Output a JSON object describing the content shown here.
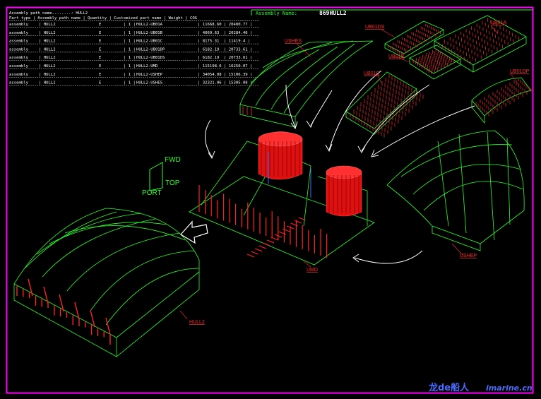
{
  "header": {
    "assembly_label": "Assembly Name:",
    "assembly_value": "869HULL2"
  },
  "table": {
    "path_line": "Assembly path name........: HULL2",
    "columns": [
      "Part type",
      "Assembly path name",
      "Quantity",
      "Customized part name",
      "Weight",
      "COG"
    ],
    "rows": [
      [
        "assembly",
        "HULL2",
        "E",
        "1",
        "HULL2-UB01A",
        "11668.60",
        "20480.77"
      ],
      [
        "assembly",
        "HULL2",
        "E",
        "1",
        "HULL2-UB01B",
        "4069.63",
        "20284.46"
      ],
      [
        "assembly",
        "HULL2",
        "E",
        "1",
        "HULL2-UB01C",
        "8175.31",
        "11419.4"
      ],
      [
        "assembly",
        "HULL2",
        "E",
        "1",
        "HULL2-UB01DP",
        "6182.19",
        "20733.61"
      ],
      [
        "assembly",
        "HULL2",
        "E",
        "1",
        "HULL2-UB01DS",
        "6182.19",
        "20733.61"
      ],
      [
        "assembly",
        "HULL2",
        "E",
        "1",
        "HULL2-UMD",
        "115198.6",
        "16250.07"
      ],
      [
        "assembly",
        "HULL2",
        "E",
        "1",
        "HULL2-USHEP",
        "34054.08",
        "15106.39"
      ],
      [
        "assembly",
        "HULL2",
        "E",
        "1",
        "HULL2-USHES",
        "32321.06",
        "15305.08"
      ]
    ]
  },
  "labels": {
    "ushes": "USHES",
    "ub01ds": "UB01DS",
    "ub01a": "UB01A",
    "ub01b": "UB01B",
    "ub01c": "UB01C",
    "ub01dp": "UB01DP",
    "ushep": "USHEP",
    "umd": "UMD",
    "hull2": "HULL2"
  },
  "axes": {
    "fwd": "FWD",
    "top": "TOP",
    "port": "PORT"
  },
  "watermark": {
    "cn": "龙de船人",
    "en": "imarine.cn"
  },
  "colors": {
    "border": "#ff00ff",
    "wire": "#2aff2a",
    "structure": "#ff2020",
    "label": "#ff2a2a",
    "text": "#ffffff"
  }
}
